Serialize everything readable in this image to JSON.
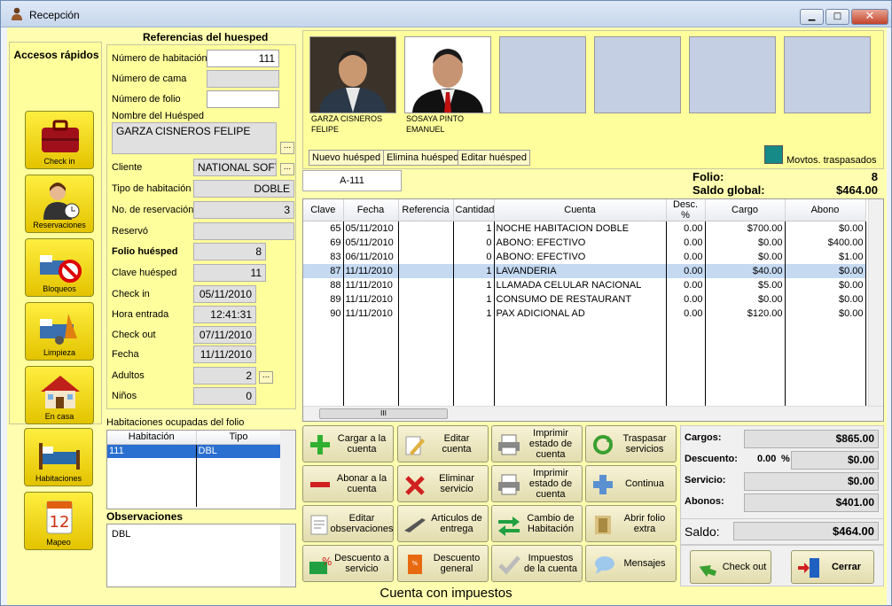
{
  "window": {
    "title": "Recepción",
    "btn_min": "▁",
    "btn_max": "□",
    "btn_close": "✕"
  },
  "quick": {
    "title": "Accesos rápidos",
    "items": [
      {
        "label": "Check in",
        "icon": "suitcase-icon"
      },
      {
        "label": "Reservaciones",
        "icon": "receptionist-icon"
      },
      {
        "label": "Bloqueos",
        "icon": "blocked-bed-icon"
      },
      {
        "label": "Limpieza",
        "icon": "cleaning-icon"
      },
      {
        "label": "En casa",
        "icon": "house-icon"
      },
      {
        "label": "Habitaciones",
        "icon": "bed-icon"
      },
      {
        "label": "Mapeo",
        "icon": "calendar-icon"
      }
    ]
  },
  "refs": {
    "title": "Referencias del huesped",
    "numero_habitacion": {
      "label": "Número de habitación",
      "value": "111"
    },
    "numero_cama": {
      "label": "Número de cama",
      "value": ""
    },
    "numero_folio": {
      "label": "Número de folio",
      "value": ""
    },
    "nombre": {
      "label": "Nombre del Huésped",
      "value": "GARZA CISNEROS FELIPE"
    },
    "cliente": {
      "label": "Cliente",
      "value": "NATIONAL SOFT"
    },
    "tipo_hab": {
      "label": "Tipo de habitación",
      "value": "DOBLE"
    },
    "no_reserv": {
      "label": "No. de reservación",
      "value": "3"
    },
    "reservo": {
      "label": "Reservó",
      "value": ""
    },
    "folio_huesped": {
      "label": "Folio huésped",
      "value": "8"
    },
    "clave_huesped": {
      "label": "Clave huésped",
      "value": "11"
    },
    "check_in": {
      "label": "Check in",
      "value": "05/11/2010"
    },
    "hora_entrada": {
      "label": "Hora entrada",
      "value": "12:41:31"
    },
    "check_out": {
      "label": "Check out",
      "value": "07/11/2010"
    },
    "fecha": {
      "label": "Fecha",
      "value": "11/11/2010"
    },
    "adultos": {
      "label": "Adultos",
      "value": "2"
    },
    "ninos": {
      "label": "Niños",
      "value": "0"
    },
    "dots": "..."
  },
  "rooms": {
    "title": "Habitaciones ocupadas del folio",
    "col1": "Habitación",
    "col2": "Tipo",
    "rows": [
      {
        "hab": "111",
        "tipo": "DBL"
      }
    ]
  },
  "obs": {
    "title": "Observaciones",
    "text": "DBL"
  },
  "guests": [
    {
      "line1": "GARZA CISNEROS",
      "line2": "FELIPE"
    },
    {
      "line1": "SOSAYA PINTO",
      "line2": "EMANUEL"
    }
  ],
  "guest_btns": {
    "nuevo": "Nuevo huésped",
    "elimina": "Elimina huésped",
    "editar": "Editar huésped",
    "traspasados": "Movtos. traspasados"
  },
  "folio": {
    "tab": "A-111",
    "folio_label": "Folio:",
    "folio_value": "8",
    "saldo_label": "Saldo global:",
    "saldo_value": "$464.00"
  },
  "grid": {
    "cols": [
      "Clave",
      "Fecha",
      "Referencia",
      "Cantidad",
      "Cuenta",
      "Desc. %",
      "Cargo",
      "Abono"
    ],
    "rows": [
      [
        "65",
        "05/11/2010",
        "",
        "1",
        "NOCHE HABITACION DOBLE",
        "0.00",
        "$700.00",
        "$0.00"
      ],
      [
        "69",
        "05/11/2010",
        "",
        "0",
        "ABONO: EFECTIVO",
        "0.00",
        "$0.00",
        "$400.00"
      ],
      [
        "83",
        "06/11/2010",
        "",
        "0",
        "ABONO: EFECTIVO",
        "0.00",
        "$0.00",
        "$1.00"
      ],
      [
        "87",
        "11/11/2010",
        "",
        "1",
        "LAVANDERIA",
        "0.00",
        "$40.00",
        "$0.00"
      ],
      [
        "88",
        "11/11/2010",
        "",
        "1",
        "LLAMADA CELULAR NACIONAL",
        "0.00",
        "$5.00",
        "$0.00"
      ],
      [
        "89",
        "11/11/2010",
        "",
        "1",
        "CONSUMO DE RESTAURANT",
        "0.00",
        "$0.00",
        "$0.00"
      ],
      [
        "90",
        "11/11/2010",
        "",
        "1",
        "PAX ADICIONAL AD",
        "0.00",
        "$120.00",
        "$0.00"
      ]
    ],
    "scroll_grip": "III"
  },
  "actions": [
    [
      "Cargar a la cuenta",
      "Editar cuenta",
      "Imprimir estado de cuenta",
      "Traspasar servicios"
    ],
    [
      "Abonar a la cuenta",
      "Eliminar servicio",
      "Imprimir estado de cuenta",
      "Continua"
    ],
    [
      "Editar observaciones",
      "Articulos de entrega",
      "Cambio de Habitación",
      "Abrir folio extra"
    ],
    [
      "Descuento a servicio",
      "Descuento general",
      "Impuestos de la cuenta",
      "Mensajes"
    ]
  ],
  "totals": {
    "cargos_label": "Cargos:",
    "cargos": "$865.00",
    "descuento_label": "Descuento:",
    "descuento_pct": "0.00",
    "pct": "%",
    "descuento": "$0.00",
    "servicio_label": "Servicio:",
    "servicio": "$0.00",
    "abonos_label": "Abonos:",
    "abonos": "$401.00",
    "saldo_label": "Saldo:",
    "saldo": "$464.00"
  },
  "bottom": {
    "checkout": "Check out",
    "cerrar": "Cerrar",
    "status": "Cuenta con impuestos"
  }
}
